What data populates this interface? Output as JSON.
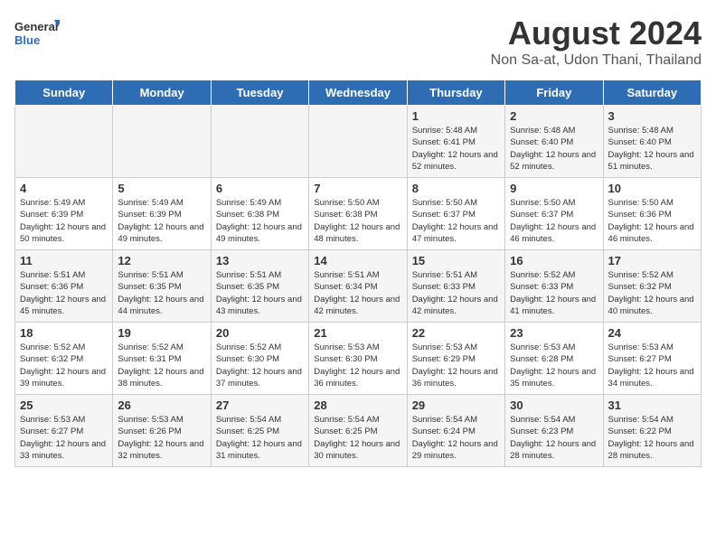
{
  "header": {
    "logo_general": "General",
    "logo_blue": "Blue",
    "main_title": "August 2024",
    "sub_title": "Non Sa-at, Udon Thani, Thailand"
  },
  "days": [
    "Sunday",
    "Monday",
    "Tuesday",
    "Wednesday",
    "Thursday",
    "Friday",
    "Saturday"
  ],
  "weeks": [
    [
      {
        "date": "",
        "info": ""
      },
      {
        "date": "",
        "info": ""
      },
      {
        "date": "",
        "info": ""
      },
      {
        "date": "",
        "info": ""
      },
      {
        "date": "1",
        "info": "Sunrise: 5:48 AM\nSunset: 6:41 PM\nDaylight: 12 hours\nand 52 minutes."
      },
      {
        "date": "2",
        "info": "Sunrise: 5:48 AM\nSunset: 6:40 PM\nDaylight: 12 hours\nand 52 minutes."
      },
      {
        "date": "3",
        "info": "Sunrise: 5:48 AM\nSunset: 6:40 PM\nDaylight: 12 hours\nand 51 minutes."
      }
    ],
    [
      {
        "date": "4",
        "info": "Sunrise: 5:49 AM\nSunset: 6:39 PM\nDaylight: 12 hours\nand 50 minutes."
      },
      {
        "date": "5",
        "info": "Sunrise: 5:49 AM\nSunset: 6:39 PM\nDaylight: 12 hours\nand 49 minutes."
      },
      {
        "date": "6",
        "info": "Sunrise: 5:49 AM\nSunset: 6:38 PM\nDaylight: 12 hours\nand 49 minutes."
      },
      {
        "date": "7",
        "info": "Sunrise: 5:50 AM\nSunset: 6:38 PM\nDaylight: 12 hours\nand 48 minutes."
      },
      {
        "date": "8",
        "info": "Sunrise: 5:50 AM\nSunset: 6:37 PM\nDaylight: 12 hours\nand 47 minutes."
      },
      {
        "date": "9",
        "info": "Sunrise: 5:50 AM\nSunset: 6:37 PM\nDaylight: 12 hours\nand 46 minutes."
      },
      {
        "date": "10",
        "info": "Sunrise: 5:50 AM\nSunset: 6:36 PM\nDaylight: 12 hours\nand 46 minutes."
      }
    ],
    [
      {
        "date": "11",
        "info": "Sunrise: 5:51 AM\nSunset: 6:36 PM\nDaylight: 12 hours\nand 45 minutes."
      },
      {
        "date": "12",
        "info": "Sunrise: 5:51 AM\nSunset: 6:35 PM\nDaylight: 12 hours\nand 44 minutes."
      },
      {
        "date": "13",
        "info": "Sunrise: 5:51 AM\nSunset: 6:35 PM\nDaylight: 12 hours\nand 43 minutes."
      },
      {
        "date": "14",
        "info": "Sunrise: 5:51 AM\nSunset: 6:34 PM\nDaylight: 12 hours\nand 42 minutes."
      },
      {
        "date": "15",
        "info": "Sunrise: 5:51 AM\nSunset: 6:33 PM\nDaylight: 12 hours\nand 42 minutes."
      },
      {
        "date": "16",
        "info": "Sunrise: 5:52 AM\nSunset: 6:33 PM\nDaylight: 12 hours\nand 41 minutes."
      },
      {
        "date": "17",
        "info": "Sunrise: 5:52 AM\nSunset: 6:32 PM\nDaylight: 12 hours\nand 40 minutes."
      }
    ],
    [
      {
        "date": "18",
        "info": "Sunrise: 5:52 AM\nSunset: 6:32 PM\nDaylight: 12 hours\nand 39 minutes."
      },
      {
        "date": "19",
        "info": "Sunrise: 5:52 AM\nSunset: 6:31 PM\nDaylight: 12 hours\nand 38 minutes."
      },
      {
        "date": "20",
        "info": "Sunrise: 5:52 AM\nSunset: 6:30 PM\nDaylight: 12 hours\nand 37 minutes."
      },
      {
        "date": "21",
        "info": "Sunrise: 5:53 AM\nSunset: 6:30 PM\nDaylight: 12 hours\nand 36 minutes."
      },
      {
        "date": "22",
        "info": "Sunrise: 5:53 AM\nSunset: 6:29 PM\nDaylight: 12 hours\nand 36 minutes."
      },
      {
        "date": "23",
        "info": "Sunrise: 5:53 AM\nSunset: 6:28 PM\nDaylight: 12 hours\nand 35 minutes."
      },
      {
        "date": "24",
        "info": "Sunrise: 5:53 AM\nSunset: 6:27 PM\nDaylight: 12 hours\nand 34 minutes."
      }
    ],
    [
      {
        "date": "25",
        "info": "Sunrise: 5:53 AM\nSunset: 6:27 PM\nDaylight: 12 hours\nand 33 minutes."
      },
      {
        "date": "26",
        "info": "Sunrise: 5:53 AM\nSunset: 6:26 PM\nDaylight: 12 hours\nand 32 minutes."
      },
      {
        "date": "27",
        "info": "Sunrise: 5:54 AM\nSunset: 6:25 PM\nDaylight: 12 hours\nand 31 minutes."
      },
      {
        "date": "28",
        "info": "Sunrise: 5:54 AM\nSunset: 6:25 PM\nDaylight: 12 hours\nand 30 minutes."
      },
      {
        "date": "29",
        "info": "Sunrise: 5:54 AM\nSunset: 6:24 PM\nDaylight: 12 hours\nand 29 minutes."
      },
      {
        "date": "30",
        "info": "Sunrise: 5:54 AM\nSunset: 6:23 PM\nDaylight: 12 hours\nand 28 minutes."
      },
      {
        "date": "31",
        "info": "Sunrise: 5:54 AM\nSunset: 6:22 PM\nDaylight: 12 hours\nand 28 minutes."
      }
    ]
  ]
}
